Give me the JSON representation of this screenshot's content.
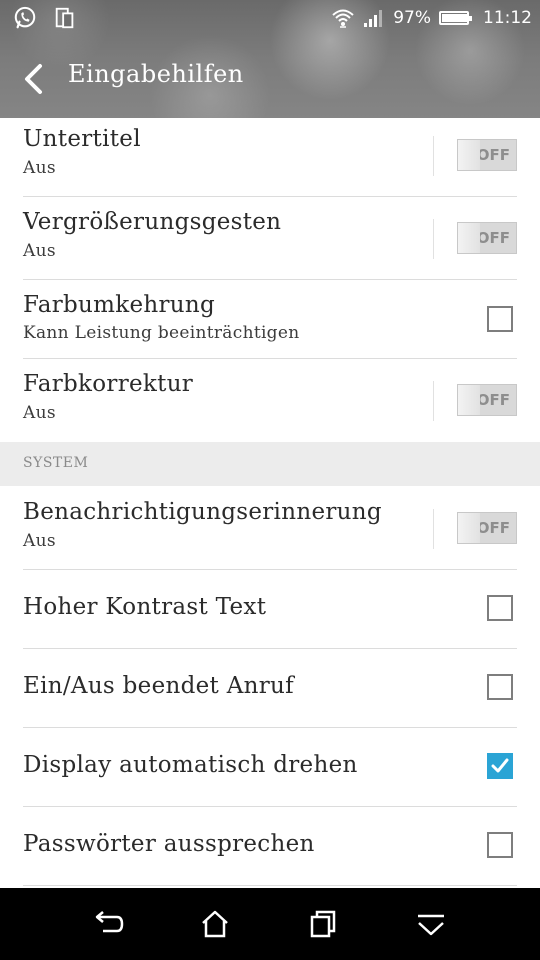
{
  "status_bar": {
    "left_icons": [
      "whatsapp-icon",
      "sim-card-icon"
    ],
    "battery_percent": "97%",
    "battery_level": 0.97,
    "time": "11:12"
  },
  "action_bar": {
    "title": "Eingabehilfen"
  },
  "settings": {
    "rows": [
      {
        "title": "Untertitel",
        "subtitle": "Aus",
        "control": "toggle",
        "control_label": "OFF"
      },
      {
        "title": "Vergrößerungsgesten",
        "subtitle": "Aus",
        "control": "toggle",
        "control_label": "OFF"
      },
      {
        "title": "Farbumkehrung",
        "subtitle": "Kann Leistung beeinträchtigen",
        "control": "checkbox",
        "checked": false
      },
      {
        "title": "Farbkorrektur",
        "subtitle": "Aus",
        "control": "toggle",
        "control_label": "OFF"
      }
    ],
    "section_system": "SYSTEM",
    "system_rows": [
      {
        "title": "Benachrichtigungserinnerung",
        "subtitle": "Aus",
        "control": "toggle",
        "control_label": "OFF"
      },
      {
        "title": "Hoher Kontrast Text",
        "control": "checkbox",
        "checked": false
      },
      {
        "title": "Ein/Aus beendet Anruf",
        "control": "checkbox",
        "checked": false
      },
      {
        "title": "Display automatisch drehen",
        "control": "checkbox",
        "checked": true
      },
      {
        "title": "Passwörter aussprechen",
        "control": "checkbox",
        "checked": false
      }
    ]
  },
  "nav_bar": {
    "buttons": [
      "back-icon",
      "home-icon",
      "recent-apps-icon",
      "hide-keyboard-icon"
    ]
  },
  "colors": {
    "accent": "#2aa4d5",
    "navbar": "#000000",
    "section_bg": "#ececec"
  }
}
